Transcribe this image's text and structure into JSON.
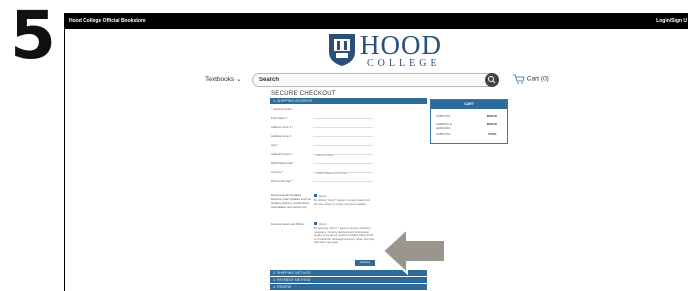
{
  "step": {
    "number": "5"
  },
  "topbar": {
    "store_name": "Hood College Official Bookstore",
    "login": "Login/Sign U"
  },
  "logo": {
    "wordmark": "HOOD",
    "sub": "COLLEGE",
    "crest_year": "1893"
  },
  "nav": {
    "textbooks": "Textbooks",
    "search_placeholder": "Search",
    "cart": "Cart (0)"
  },
  "checkout": {
    "title": "SECURE CHECKOUT",
    "sections": [
      "1. SHIPPING ADDRESS",
      "2. SHIPPING METHOD",
      "3. PAYMENT METHOD",
      "4. REVIEW"
    ],
    "required_note": "* required fields",
    "fields": [
      {
        "label": "First Name *",
        "value": ""
      },
      {
        "label": "Address Line 1 *",
        "value": ""
      },
      {
        "label": "Address Line 2",
        "value": ""
      },
      {
        "label": "City *",
        "value": ""
      },
      {
        "label": "State/Province *",
        "value": "Select a State"
      },
      {
        "label": "Zip/Postal Code *",
        "value": ""
      },
      {
        "label": "Country *",
        "value": "United States of America"
      },
      {
        "label": "Phone Number *",
        "value": ""
      }
    ],
    "email_optin": {
      "label": "Receive Email Updates",
      "desc": "Receive order updates such as shipping delivery confirmation, cancellation and returns etc.",
      "yes": "Opt-in",
      "text": "By clicking \"Opt-in\" I agree to receive status from the store about my orders and future updates."
    },
    "sms_optin": {
      "label": "Receive News and Offers",
      "yes": "Opt-in",
      "text": "By selecting \"Opt-in\" I agree to receive marketing messages, including discounts and promotional emails, at the phone number provided. Reply STOP to unsubscribe. Message frequency varies. Msg and data rates may apply."
    },
    "continue": "Continue"
  },
  "cart_summary": {
    "title": "CART",
    "rows": [
      {
        "label": "SUBTOTAL",
        "value": "$000.00"
      },
      {
        "label": "SHIPPING &",
        "value": "$000.00"
      },
      {
        "label": "HANDLING",
        "value": ""
      },
      {
        "label": "SUBTOTAL",
        "value": "TOTAL"
      }
    ]
  },
  "colors": {
    "accent": "#2d6b9a",
    "topbar": "#000000",
    "arrow": "#9a958d",
    "brand": "#2b4f7b"
  }
}
